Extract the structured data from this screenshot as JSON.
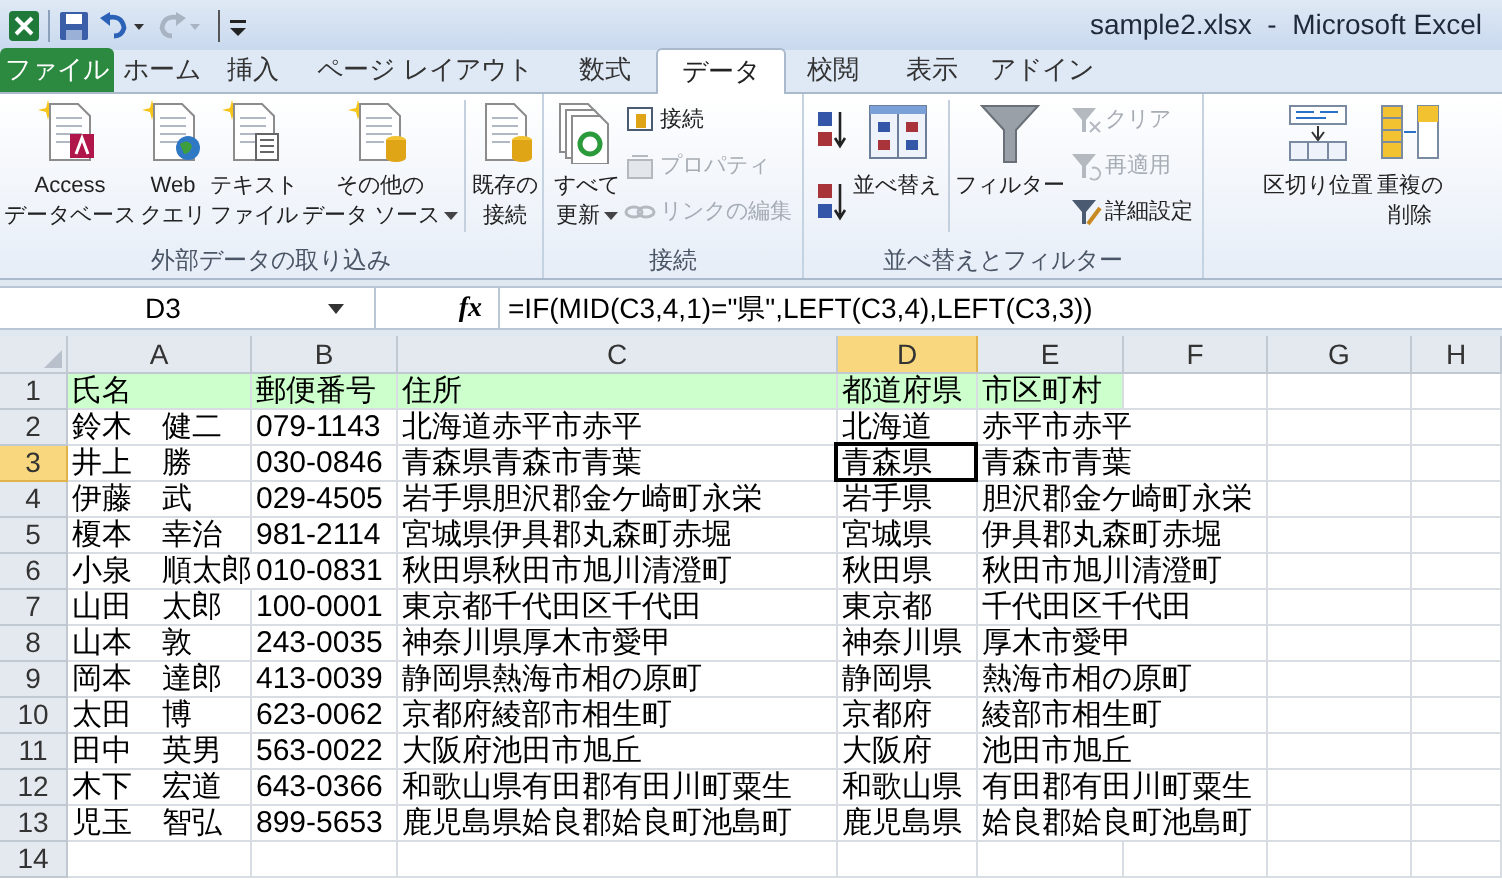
{
  "window": {
    "title": "sample2.xlsx  -  Microsoft Excel"
  },
  "tabs": [
    {
      "label": "ファイル",
      "kind": "file",
      "selected": false
    },
    {
      "label": "ホーム",
      "kind": "tab",
      "selected": false
    },
    {
      "label": "挿入",
      "kind": "tab",
      "selected": false
    },
    {
      "label": "ページ レイアウト",
      "kind": "tab",
      "selected": false
    },
    {
      "label": "数式",
      "kind": "tab",
      "selected": false
    },
    {
      "label": "データ",
      "kind": "tab",
      "selected": true
    },
    {
      "label": "校閲",
      "kind": "tab",
      "selected": false
    },
    {
      "label": "表示",
      "kind": "tab",
      "selected": false
    },
    {
      "label": "アドイン",
      "kind": "tab",
      "selected": false
    }
  ],
  "ribbon_groups": [
    {
      "label": "外部データの取り込み",
      "items": [
        {
          "kind": "large",
          "lines": [
            "Access",
            "データベース"
          ]
        },
        {
          "kind": "large",
          "lines": [
            "Web",
            "クエリ"
          ]
        },
        {
          "kind": "large",
          "lines": [
            "テキスト",
            "ファイル"
          ]
        },
        {
          "kind": "large",
          "lines": [
            "その他の",
            "データ ソース"
          ],
          "dropdown": true
        },
        {
          "kind": "large",
          "lines": [
            "既存の",
            "接続"
          ],
          "separator": true
        }
      ]
    },
    {
      "label": "接続",
      "items": [
        {
          "kind": "large",
          "lines": [
            "すべて",
            "更新"
          ],
          "dropdown": true
        },
        {
          "kind": "stack",
          "items": [
            {
              "label": "接続",
              "disabled": false
            },
            {
              "label": "プロパティ",
              "disabled": true
            },
            {
              "label": "リンクの編集",
              "disabled": true
            }
          ]
        }
      ]
    },
    {
      "label": "並べ替えとフィルター",
      "items": [
        {
          "kind": "sort"
        },
        {
          "kind": "large",
          "lines": [
            "並べ替え"
          ]
        },
        {
          "kind": "large",
          "lines": [
            "フィルター"
          ],
          "separator": true
        },
        {
          "kind": "stack",
          "items": [
            {
              "label": "クリア",
              "disabled": true
            },
            {
              "label": "再適用",
              "disabled": true
            },
            {
              "label": "詳細設定",
              "disabled": false
            }
          ]
        }
      ]
    },
    {
      "items": [
        {
          "kind": "large",
          "lines": [
            "区切り位置"
          ]
        },
        {
          "kind": "large",
          "lines": [
            "重複の",
            "削除"
          ]
        }
      ]
    }
  ],
  "formula_bar": {
    "name_box": "D3",
    "function_button": "fx",
    "formula": "=IF(MID(C3,4,1)=\"県\",LEFT(C3,4),LEFT(C3,3))"
  },
  "columns": [
    {
      "label": "A",
      "selected": false
    },
    {
      "label": "B",
      "selected": false
    },
    {
      "label": "C",
      "selected": false
    },
    {
      "label": "D",
      "selected": true
    },
    {
      "label": "E",
      "selected": false
    },
    {
      "label": "F",
      "selected": false
    },
    {
      "label": "G",
      "selected": false
    },
    {
      "label": "H",
      "selected": false
    }
  ],
  "rows": [
    {
      "number": "1",
      "selected": false,
      "kind": "header",
      "cells": [
        "氏名",
        "郵便番号",
        "住所",
        "都道府県",
        "市区町村"
      ]
    },
    {
      "number": "2",
      "selected": false,
      "kind": "data",
      "cells": [
        "鈴木　健二",
        "079-1143",
        "北海道赤平市赤平",
        "北海道",
        "赤平市赤平"
      ]
    },
    {
      "number": "3",
      "selected": true,
      "kind": "data",
      "cells": [
        "井上　勝",
        "030-0846",
        "青森県青森市青葉",
        "青森県",
        "青森市青葉"
      ]
    },
    {
      "number": "4",
      "selected": false,
      "kind": "data",
      "cells": [
        "伊藤　武",
        "029-4505",
        "岩手県胆沢郡金ケ崎町永栄",
        "岩手県",
        "胆沢郡金ケ崎町永栄"
      ]
    },
    {
      "number": "5",
      "selected": false,
      "kind": "data",
      "cells": [
        "榎本　幸治",
        "981-2114",
        "宮城県伊具郡丸森町赤堀",
        "宮城県",
        "伊具郡丸森町赤堀"
      ]
    },
    {
      "number": "6",
      "selected": false,
      "kind": "data",
      "cells": [
        "小泉　順太郎",
        "010-0831",
        "秋田県秋田市旭川清澄町",
        "秋田県",
        "秋田市旭川清澄町"
      ]
    },
    {
      "number": "7",
      "selected": false,
      "kind": "data",
      "cells": [
        "山田　太郎",
        "100-0001",
        "東京都千代田区千代田",
        "東京都",
        "千代田区千代田"
      ]
    },
    {
      "number": "8",
      "selected": false,
      "kind": "data",
      "cells": [
        "山本　敦",
        "243-0035",
        "神奈川県厚木市愛甲",
        "神奈川県",
        "厚木市愛甲"
      ]
    },
    {
      "number": "9",
      "selected": false,
      "kind": "data",
      "cells": [
        "岡本　達郎",
        "413-0039",
        "静岡県熱海市相の原町",
        "静岡県",
        "熱海市相の原町"
      ]
    },
    {
      "number": "10",
      "selected": false,
      "kind": "data",
      "cells": [
        "太田　博",
        "623-0062",
        "京都府綾部市相生町",
        "京都府",
        "綾部市相生町"
      ]
    },
    {
      "number": "11",
      "selected": false,
      "kind": "data",
      "cells": [
        "田中　英男",
        "563-0022",
        "大阪府池田市旭丘",
        "大阪府",
        "池田市旭丘"
      ]
    },
    {
      "number": "12",
      "selected": false,
      "kind": "data",
      "cells": [
        "木下　宏道",
        "643-0366",
        "和歌山県有田郡有田川町粟生",
        "和歌山県",
        "有田郡有田川町粟生"
      ]
    },
    {
      "number": "13",
      "selected": false,
      "kind": "data",
      "cells": [
        "児玉　智弘",
        "899-5653",
        "鹿児島県姶良郡姶良町池島町",
        "鹿児島県",
        "姶良郡姶良町池島町"
      ]
    },
    {
      "number": "14",
      "selected": false,
      "kind": "empty",
      "cells": []
    }
  ]
}
